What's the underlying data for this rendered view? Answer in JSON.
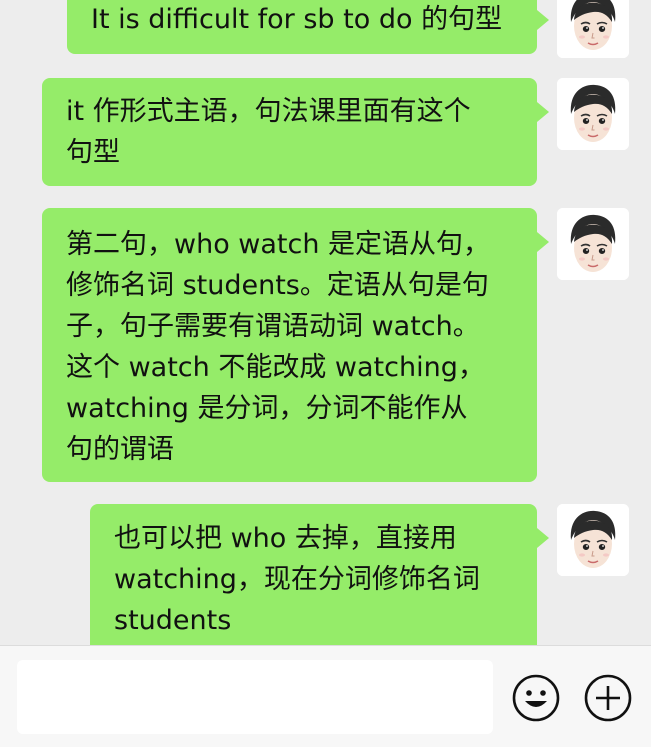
{
  "messages": [
    {
      "sender": "self",
      "lines": [
        "It is difficult for sb to do 的句型"
      ]
    },
    {
      "sender": "self",
      "lines": [
        "it 作形式主语，句法课里面有这个",
        "句型"
      ]
    },
    {
      "sender": "self",
      "lines": [
        "第二句，who watch 是定语从句，",
        "修饰名词 students。定语从句是句",
        "子，句子需要有谓语动词 watch。",
        "这个 watch 不能改成 watching，",
        "watching 是分词，分词不能作从",
        "句的谓语"
      ]
    },
    {
      "sender": "self",
      "lines": [
        "也可以把 who 去掉，直接用",
        "watching，现在分词修饰名词",
        "students"
      ]
    }
  ],
  "input": {
    "value": "",
    "placeholder": ""
  },
  "icons": {
    "avatar": "avatar-icon",
    "emoji": "emoji-icon",
    "plus": "plus-icon"
  },
  "colors": {
    "bubble": "#95ec69",
    "background": "#ededed"
  }
}
